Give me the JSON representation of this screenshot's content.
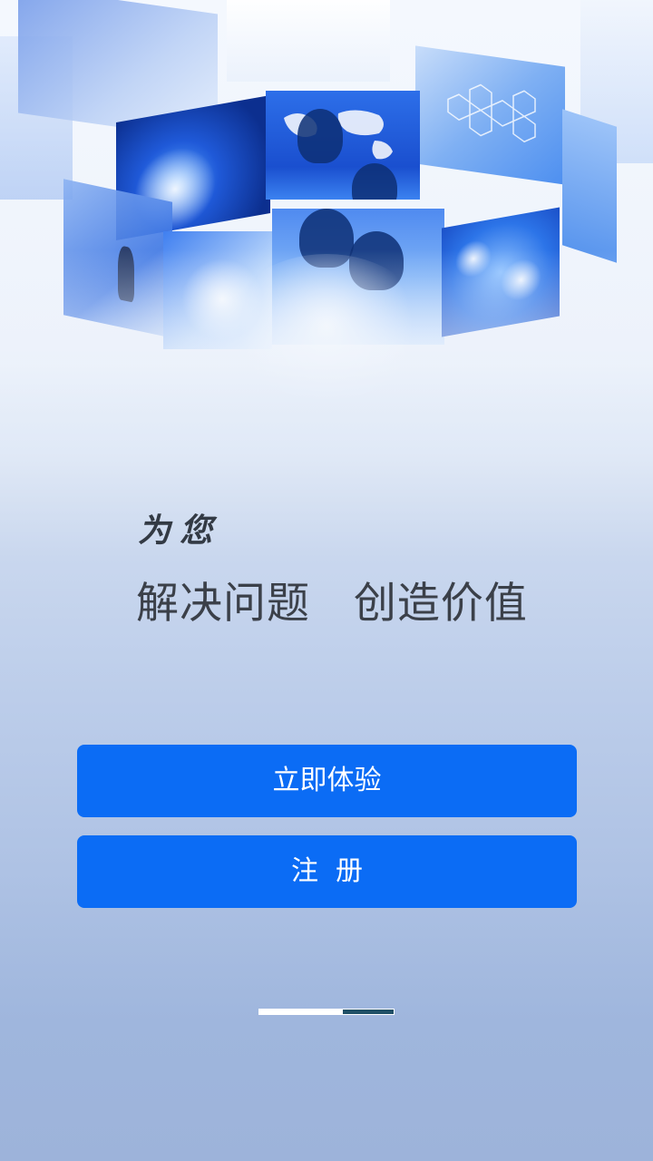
{
  "hero": {
    "image_name": "technology-collage-illustration"
  },
  "slogan": {
    "small": "为您",
    "big": "解决问题   创造价值"
  },
  "buttons": {
    "try_now": "立即体验",
    "register": "注  册"
  },
  "pager": {
    "page_count": 2,
    "active_index": 0
  },
  "colors": {
    "button_blue": "#0b6cf5",
    "pager_inactive": "#1f4f66",
    "text_dark": "#3b4049"
  }
}
